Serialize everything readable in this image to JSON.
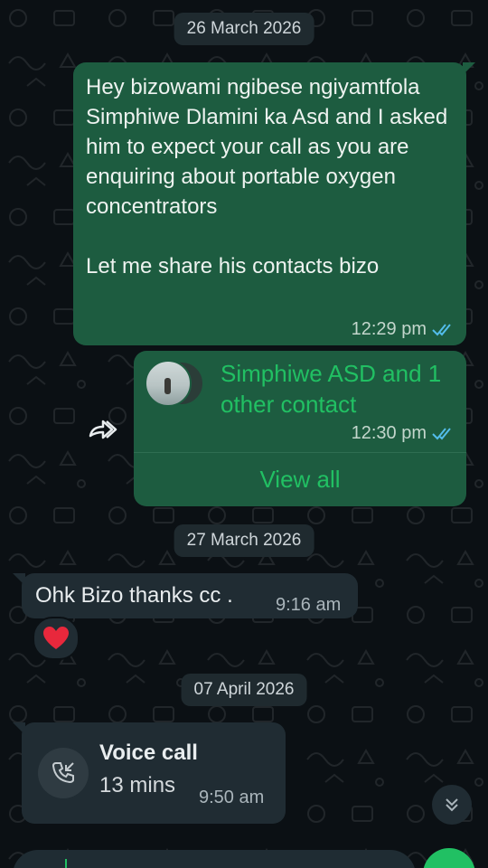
{
  "dates": [
    "26 March 2026",
    "27 March 2026",
    "07 April 2026"
  ],
  "message1": {
    "text": "Hey bizowami ngibese ngiyamtfola Simphiwe Dlamini ka Asd and I asked him to expect your call as you are enquiring about portable oxygen concentrators\n\nLet me share his contacts bizo",
    "time": "12:29 pm",
    "status_icon": "double-check-icon"
  },
  "contact_card": {
    "name": "Simphiwe ASD and 1 other contact",
    "time": "12:30 pm",
    "action": "View all",
    "forward_icon": "forward-icon"
  },
  "message2": {
    "text": "Ohk Bizo thanks cc .",
    "time": "9:16 am",
    "reaction": "❤️"
  },
  "voice_call": {
    "title": "Voice call",
    "duration": "13 mins",
    "time": "9:50 am",
    "icon": "missed-call-icon"
  },
  "scroll_down_icon": "double-chevron-down-icon",
  "colors": {
    "background": "#0b1014",
    "outgoing_bubble": "#1d5c40",
    "incoming_bubble": "#202c33",
    "accent_green": "#21c063",
    "read_ticks": "#53bdeb"
  }
}
